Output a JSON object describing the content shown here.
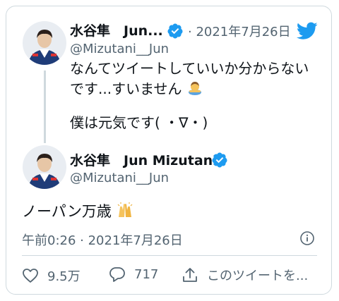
{
  "reply_tweet": {
    "display_name": "水谷隼　Jun...",
    "handle": "@Mizutani__Jun",
    "date": "· 2021年7月26日",
    "line1": "なんてツイートしていいか分からない",
    "line2": "です...すいません",
    "line3": "僕は元気です( ・∇・)"
  },
  "main_tweet": {
    "display_name": "水谷隼　Jun Mizutani",
    "handle": "@Mizutani__Jun",
    "text": "ノーパン万歳",
    "timestamp": "午前0:26 · 2021年7月26日"
  },
  "actions": {
    "likes": "9.5万",
    "replies": "717",
    "share_label": "このツイートを..."
  },
  "colors": {
    "accent": "#1d9bf0",
    "secondary_text": "#536471",
    "border": "#cfd9de"
  },
  "icons": [
    "twitter-bird-icon",
    "verified-badge-icon",
    "info-icon",
    "heart-icon",
    "reply-bubble-icon",
    "share-icon"
  ]
}
